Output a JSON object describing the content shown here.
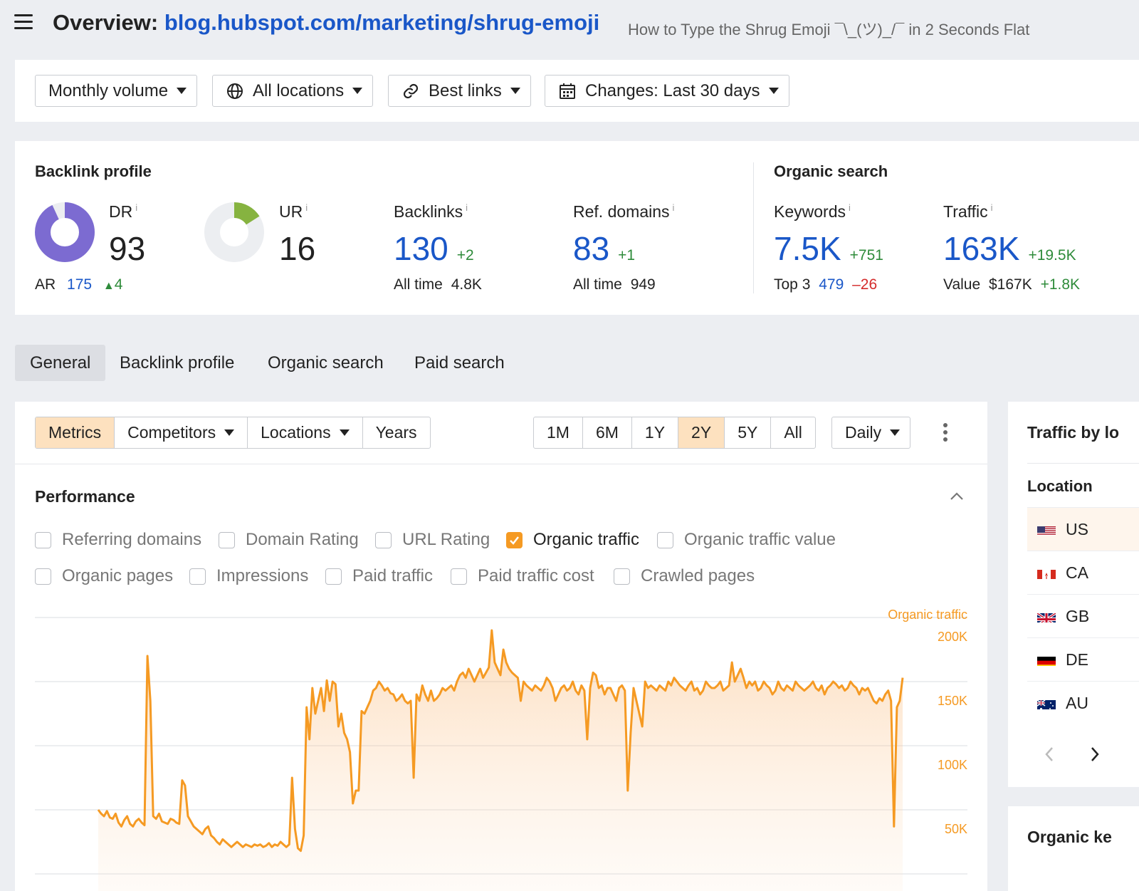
{
  "header": {
    "title_prefix": "Overview:",
    "url": "blog.hubspot.com/marketing/shrug-emoji",
    "page_title": "How to Type the Shrug Emoji ¯\\_(ツ)_/¯ in 2 Seconds Flat"
  },
  "filters": {
    "volume": "Monthly volume",
    "locations": "All locations",
    "links": "Best links",
    "changes": "Changes: Last 30 days"
  },
  "backlink_profile": {
    "heading": "Backlink profile",
    "dr": {
      "label": "DR",
      "value": "93",
      "fraction": 0.93
    },
    "ar": {
      "label": "AR",
      "value": "175",
      "delta": "4"
    },
    "ur": {
      "label": "UR",
      "value": "16",
      "fraction": 0.16
    },
    "backlinks": {
      "label": "Backlinks",
      "value": "130",
      "delta": "+2",
      "sub_label": "All time",
      "sub_value": "4.8K"
    },
    "ref_domains": {
      "label": "Ref. domains",
      "value": "83",
      "delta": "+1",
      "sub_label": "All time",
      "sub_value": "949"
    }
  },
  "organic_search": {
    "heading": "Organic search",
    "keywords": {
      "label": "Keywords",
      "value": "7.5K",
      "delta": "+751",
      "sub_label": "Top 3",
      "sub_value": "479",
      "sub_delta": "–26"
    },
    "traffic": {
      "label": "Traffic",
      "value": "163K",
      "delta": "+19.5K",
      "sub_label": "Value",
      "sub_value": "$167K",
      "sub_delta": "+1.8K"
    }
  },
  "tabs": [
    "General",
    "Backlink profile",
    "Organic search",
    "Paid search"
  ],
  "toolbar": {
    "view_tabs": [
      "Metrics",
      "Competitors",
      "Locations",
      "Years"
    ],
    "ranges": [
      "1M",
      "6M",
      "1Y",
      "2Y",
      "5Y",
      "All"
    ],
    "active_range": "2Y",
    "granularity": "Daily"
  },
  "performance": {
    "title": "Performance",
    "metrics_row1": [
      "Referring domains",
      "Domain Rating",
      "URL Rating",
      "Organic traffic",
      "Organic traffic value"
    ],
    "metrics_row2": [
      "Organic pages",
      "Impressions",
      "Paid traffic",
      "Paid traffic cost",
      "Crawled pages"
    ],
    "checked": "Organic traffic"
  },
  "colors": {
    "accent": "#f59a23",
    "link_blue": "#1a57c8",
    "positive": "#2e8b3a",
    "negative": "#d42b2b"
  },
  "chart_data": {
    "type": "area",
    "series": [
      {
        "name": "Organic traffic"
      }
    ],
    "ylim": [
      30000,
      215000
    ],
    "y_ticks": [
      "200K",
      "150K",
      "100K",
      "50K"
    ],
    "y_tick_values": [
      200000,
      150000,
      100000,
      50000
    ],
    "grid": true,
    "values": [
      65000,
      62000,
      60000,
      64000,
      59000,
      58000,
      62000,
      55000,
      52000,
      57000,
      60000,
      54000,
      52000,
      56000,
      58000,
      55000,
      53000,
      185000,
      150000,
      60000,
      58000,
      62000,
      56000,
      55000,
      54000,
      58000,
      57000,
      55000,
      54000,
      88000,
      84000,
      60000,
      56000,
      52000,
      50000,
      48000,
      46000,
      50000,
      52000,
      45000,
      43000,
      40000,
      38000,
      42000,
      40000,
      38000,
      36000,
      38000,
      40000,
      38000,
      36000,
      38000,
      37000,
      36000,
      38000,
      37000,
      38000,
      36000,
      37000,
      39000,
      36000,
      38000,
      37000,
      40000,
      38000,
      36000,
      38000,
      90000,
      50000,
      35000,
      33000,
      45000,
      145000,
      120000,
      160000,
      140000,
      150000,
      160000,
      142000,
      166000,
      150000,
      165000,
      163000,
      130000,
      140000,
      125000,
      120000,
      110000,
      70000,
      80000,
      80000,
      142000,
      140000,
      145000,
      150000,
      158000,
      160000,
      165000,
      162000,
      158000,
      160000,
      156000,
      155000,
      150000,
      152000,
      155000,
      150000,
      148000,
      150000,
      90000,
      155000,
      150000,
      162000,
      155000,
      150000,
      158000,
      150000,
      152000,
      155000,
      160000,
      158000,
      160000,
      162000,
      158000,
      165000,
      170000,
      172000,
      168000,
      175000,
      170000,
      165000,
      170000,
      175000,
      168000,
      172000,
      176000,
      205000,
      180000,
      175000,
      170000,
      190000,
      180000,
      175000,
      172000,
      170000,
      168000,
      150000,
      165000,
      162000,
      160000,
      158000,
      162000,
      160000,
      158000,
      162000,
      168000,
      165000,
      160000,
      150000,
      155000,
      160000,
      162000,
      158000,
      160000,
      165000,
      158000,
      155000,
      162000,
      158000,
      120000,
      160000,
      172000,
      170000,
      160000,
      162000,
      155000,
      160000,
      160000,
      155000,
      150000,
      160000,
      162000,
      158000,
      80000,
      125000,
      160000,
      150000,
      140000,
      130000,
      165000,
      160000,
      162000,
      160000,
      158000,
      162000,
      160000,
      158000,
      165000,
      162000,
      168000,
      165000,
      162000,
      160000,
      158000,
      162000,
      165000,
      158000,
      160000,
      155000,
      158000,
      165000,
      162000,
      160000,
      160000,
      162000,
      165000,
      158000,
      160000,
      162000,
      180000,
      165000,
      170000,
      175000,
      168000,
      160000,
      165000,
      162000,
      165000,
      158000,
      160000,
      165000,
      162000,
      160000,
      155000,
      158000,
      165000,
      160000,
      158000,
      162000,
      160000,
      158000,
      165000,
      162000,
      160000,
      158000,
      160000,
      162000,
      165000,
      160000,
      158000,
      162000,
      155000,
      160000,
      162000,
      165000,
      163000,
      160000,
      162000,
      158000,
      160000,
      165000,
      162000,
      160000,
      155000,
      160000,
      158000,
      160000,
      155000,
      150000,
      148000,
      152000,
      150000,
      155000,
      158000,
      150000,
      52000,
      145000,
      150000,
      168000
    ]
  },
  "traffic_by_location": {
    "title": "Traffic by lo",
    "column": "Location",
    "rows": [
      "US",
      "CA",
      "GB",
      "DE",
      "AU"
    ]
  },
  "organic_keywords": {
    "title": "Organic ke"
  }
}
